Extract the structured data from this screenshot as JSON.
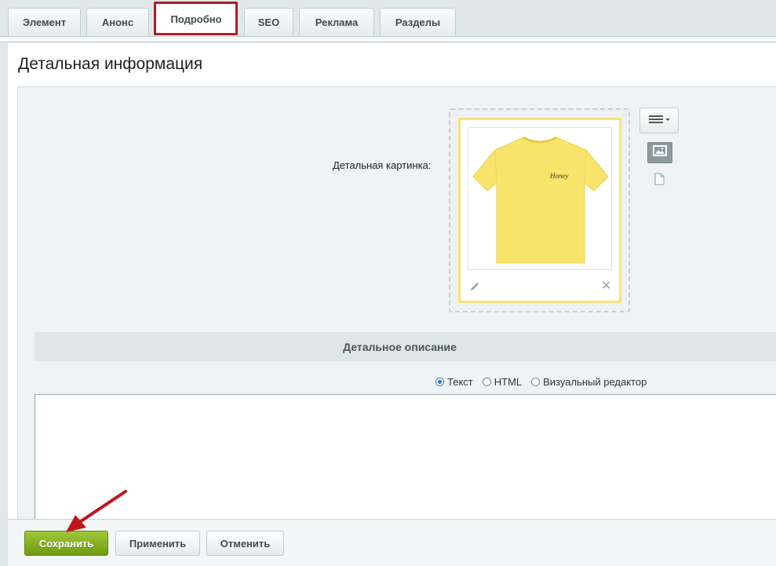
{
  "tabs": [
    {
      "label": "Элемент"
    },
    {
      "label": "Анонс"
    },
    {
      "label": "Подробно",
      "active": true
    },
    {
      "label": "SEO"
    },
    {
      "label": "Реклама"
    },
    {
      "label": "Разделы"
    }
  ],
  "section": {
    "title": "Детальная информация"
  },
  "picture": {
    "label": "Детальная картинка:",
    "print_text": "Honey",
    "icons": {
      "menu": "hamburger-menu-icon",
      "view_image": "image-icon",
      "view_file": "file-icon",
      "edit": "pencil-icon",
      "delete": "close-icon"
    }
  },
  "description": {
    "header": "Детальное описание",
    "modes": [
      {
        "label": "Текст",
        "checked": true
      },
      {
        "label": "HTML",
        "checked": false
      },
      {
        "label": "Визуальный редактор",
        "checked": false
      }
    ],
    "value": ""
  },
  "footer": {
    "save_label": "Сохранить",
    "apply_label": "Применить",
    "cancel_label": "Отменить"
  },
  "colors": {
    "active_tab_highlight": "#b01c20",
    "save_button": "#7fab1f",
    "arrow": "#c0161c",
    "tshirt": "#f9e46b"
  }
}
